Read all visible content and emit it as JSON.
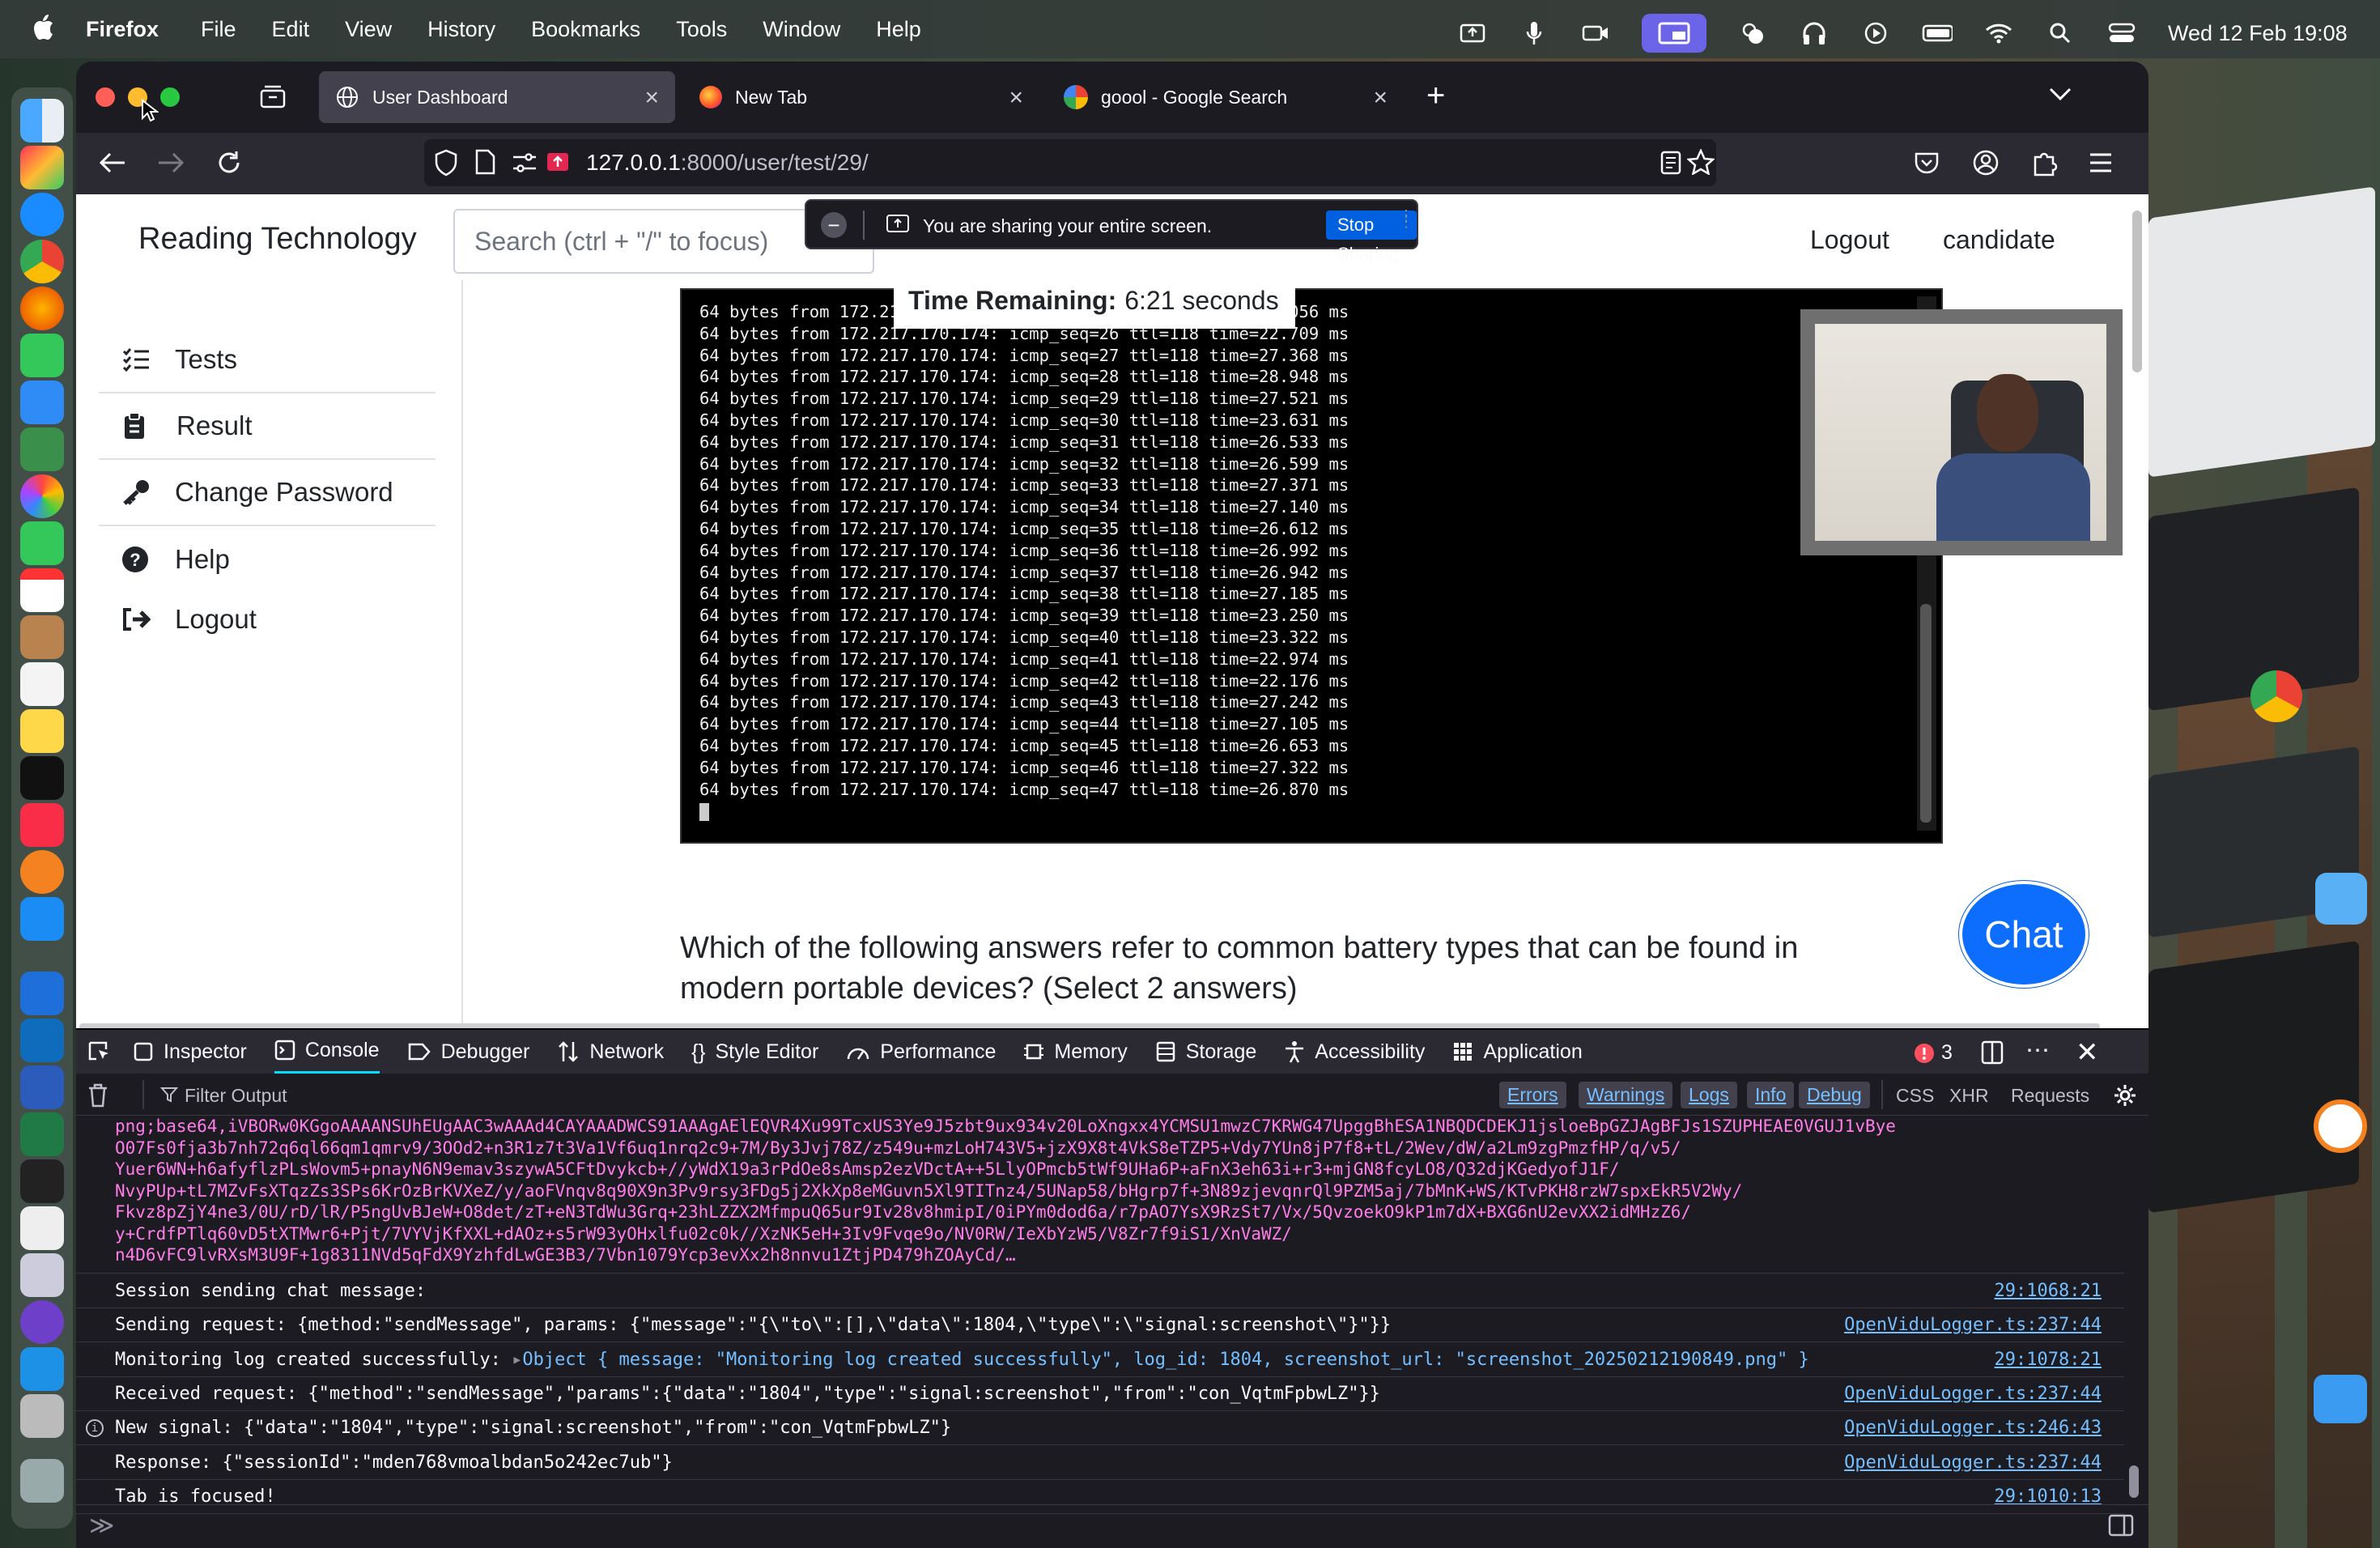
{
  "menubar": {
    "app": "Firefox",
    "items": [
      "File",
      "Edit",
      "View",
      "History",
      "Bookmarks",
      "Tools",
      "Window",
      "Help"
    ],
    "clock": "Wed 12 Feb  19:08"
  },
  "browser": {
    "tabs": [
      {
        "title": "User Dashboard",
        "active": true
      },
      {
        "title": "New Tab",
        "active": false
      },
      {
        "title": "goool - Google Search",
        "active": false
      }
    ],
    "url_host": "127.0.0.1",
    "url_path": ":8000/user/test/29/"
  },
  "sharing": {
    "text": "You are sharing your entire screen.",
    "button": "Stop Sharing"
  },
  "site": {
    "brand": "Reading Technology",
    "search_placeholder": "Search (ctrl + \"/\" to focus)",
    "logout": "Logout",
    "user": "candidate",
    "sidebar": [
      {
        "label": "Tests",
        "icon": "list-check-icon"
      },
      {
        "label": "Result",
        "icon": "clipboard-icon"
      },
      {
        "label": "Change Password",
        "icon": "key-icon"
      },
      {
        "label": "Help",
        "icon": "question-circle-icon"
      },
      {
        "label": "Logout",
        "icon": "sign-out-icon"
      }
    ],
    "timer_label": "Time Remaining:",
    "timer_value": "6:21 seconds",
    "question": "Which of the following answers refer to common battery types that can be found in modern portable devices? (Select 2 answers)",
    "chat": "Chat"
  },
  "terminal": {
    "lines": [
      "64 bytes from 172.217.170.174: icmp_seq=25 ttl=118 time=23.056 ms",
      "64 bytes from 172.217.170.174: icmp_seq=26 ttl=118 time=22.709 ms",
      "64 bytes from 172.217.170.174: icmp_seq=27 ttl=118 time=27.368 ms",
      "64 bytes from 172.217.170.174: icmp_seq=28 ttl=118 time=28.948 ms",
      "64 bytes from 172.217.170.174: icmp_seq=29 ttl=118 time=27.521 ms",
      "64 bytes from 172.217.170.174: icmp_seq=30 ttl=118 time=23.631 ms",
      "64 bytes from 172.217.170.174: icmp_seq=31 ttl=118 time=26.533 ms",
      "64 bytes from 172.217.170.174: icmp_seq=32 ttl=118 time=26.599 ms",
      "64 bytes from 172.217.170.174: icmp_seq=33 ttl=118 time=27.371 ms",
      "64 bytes from 172.217.170.174: icmp_seq=34 ttl=118 time=27.140 ms",
      "64 bytes from 172.217.170.174: icmp_seq=35 ttl=118 time=26.612 ms",
      "64 bytes from 172.217.170.174: icmp_seq=36 ttl=118 time=26.992 ms",
      "64 bytes from 172.217.170.174: icmp_seq=37 ttl=118 time=26.942 ms",
      "64 bytes from 172.217.170.174: icmp_seq=38 ttl=118 time=27.185 ms",
      "64 bytes from 172.217.170.174: icmp_seq=39 ttl=118 time=23.250 ms",
      "64 bytes from 172.217.170.174: icmp_seq=40 ttl=118 time=23.322 ms",
      "64 bytes from 172.217.170.174: icmp_seq=41 ttl=118 time=22.974 ms",
      "64 bytes from 172.217.170.174: icmp_seq=42 ttl=118 time=22.176 ms",
      "64 bytes from 172.217.170.174: icmp_seq=43 ttl=118 time=27.242 ms",
      "64 bytes from 172.217.170.174: icmp_seq=44 ttl=118 time=27.105 ms",
      "64 bytes from 172.217.170.174: icmp_seq=45 ttl=118 time=26.653 ms",
      "64 bytes from 172.217.170.174: icmp_seq=46 ttl=118 time=27.322 ms",
      "64 bytes from 172.217.170.174: icmp_seq=47 ttl=118 time=26.870 ms"
    ]
  },
  "devtools": {
    "tabs": [
      "Inspector",
      "Console",
      "Debugger",
      "Network",
      "Style Editor",
      "Performance",
      "Memory",
      "Storage",
      "Accessibility",
      "Application"
    ],
    "error_count": "3",
    "filter_placeholder": "Filter Output",
    "levels": [
      "Errors",
      "Warnings",
      "Logs",
      "Info",
      "Debug"
    ],
    "extra": [
      "CSS",
      "XHR",
      "Requests"
    ],
    "base64_lines": [
      "png;base64,iVBORw0KGgoAAAANSUhEUgAAC3wAAAd4CAYAAADWCS91AAAgAElEQVR4Xu99TcxUS3Ye9J5zbt9ux934v20LoXngxx4YCMSU1mwzC7KRWG47UpggBhESA1NBQDCDEKJ1jsloeBpGZJAgBFJs1SZUPHEAE0VGUJ1vBye",
      "O07Fs0fja3b7nh72q6ql66qm1qmrv9/3OOd2+n3R1z7t3Va1Vf6uq1nrq2c9+7M/By3Jvj78Z/z549u+mzLoH743V5+jzX9X8t4VkS8eTZP5+Vdy7YUn8jP7f8+tL/2Wev/dW/a2Lm9zgPmzfHP/q/v5/",
      "Yuer6WN+h6afyflzPLsWovm5+pnayN6N9emav3szywA5CFtDvykcb+//yWdX19a3rPdOe8sAmsp2ezVDctA++5LlyOPmcb5tWf9UHa6P+aFnX3eh63i+r3+mjGN8fcyLO8/Q32djKGedyofJ1F/",
      "NvyPUp+tL7MZvFsXTqzZs3SPs6KrOzBrKVXeZ/y/aoFVnqv8q90X9n3Pv9rsy3FDg5j2XkXp8eMGuvn5Xl9TITnz4/5UNap58/bHgrp7f+3N89zjevqnrQl9PZM5aj/7bMnK+WS/KTvPKH8rzW7spxEkR5V2Wy/",
      "Fkvz8pZjY4ne3/0U/rD/lR/P5ngUvBJeW+O8det/zT+eN3TdWu3Grq+23hLZZX2MfmpuQ65ur9Iv28v8hmipI/0iPYm0dod6a/r7pAO7YsX9RzSt7/Vx/5QvzoekO9kP1m7dX+BXG6nU2evXX2idMHzZ6/",
      "y+CrdfPTlq60vD5tXTMwr6+Pjt/7VYVjKfXXL+dAOz+s5rW93yOHxlfu02c0k//XzNK5eH+3Iv9Fvqe9o/NV0RW/IeXbYzW5/V8Zr7f9iS1/XnVaWZ/",
      "n4D6vFC9lvRXsM3U9F+1g8311NVd5qFdX9YzhfdLwGE3B3/7Vbn1079Ycp3evXx2h8nnvu1ZtjPD479hZOAyCd/…"
    ],
    "rows": [
      {
        "msg": "Session sending chat message:",
        "src": "29:1068:21"
      },
      {
        "msg": "Sending request: {method:\"sendMessage\", params: {\"message\":\"{\\\"to\\\":[],\\\"data\\\":1804,\\\"type\\\":\\\"signal:screenshot\\\"}\"}}",
        "src": "OpenViduLogger.ts:237:44"
      },
      {
        "msg": "Monitoring log created successfully: ",
        "obj": "Object { message: \"Monitoring log created successfully\", log_id: 1804, screenshot_url: \"screenshot_20250212190849.png\" }",
        "src": "29:1078:21"
      },
      {
        "msg": "Received request: {\"method\":\"sendMessage\",\"params\":{\"data\":\"1804\",\"type\":\"signal:screenshot\",\"from\":\"con_VqtmFpbwLZ\"}}",
        "src": "OpenViduLogger.ts:237:44"
      },
      {
        "msg": "New signal: {\"data\":\"1804\",\"type\":\"signal:screenshot\",\"from\":\"con_VqtmFpbwLZ\"}",
        "src": "OpenViduLogger.ts:246:43"
      },
      {
        "msg": "Response: {\"sessionId\":\"mden768vmoalbdan5o242ec7ub\"}",
        "src": "OpenViduLogger.ts:237:44"
      },
      {
        "msg": "Tab is focused!",
        "src": "29:1010:13"
      }
    ],
    "prompt": "≫"
  },
  "colors": {
    "accent": "#0d6efd",
    "console_pink": "#ff7de9",
    "link_blue": "#75bfff",
    "error_red": "#ff4f5e"
  }
}
